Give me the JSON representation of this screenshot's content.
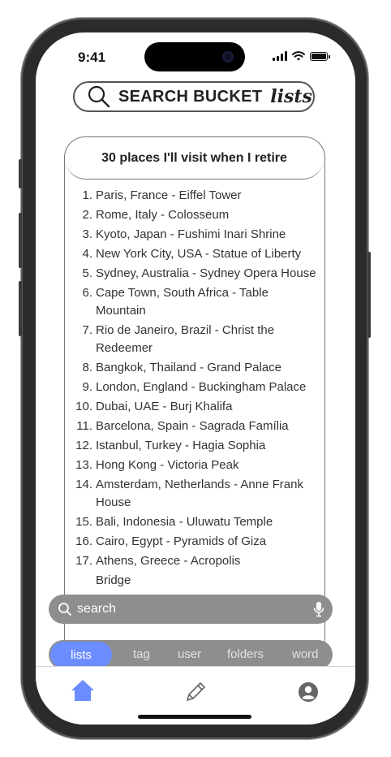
{
  "status": {
    "time": "9:41"
  },
  "header": {
    "search_label": "SEARCH BUCKET",
    "lists_label": "lists"
  },
  "list": {
    "title": "30 places I'll visit when I retire",
    "items": [
      {
        "num": "1.",
        "text": "Paris, France - Eiffel Tower"
      },
      {
        "num": "2.",
        "text": "Rome, Italy - Colosseum"
      },
      {
        "num": "3.",
        "text": "Kyoto, Japan - Fushimi Inari Shrine"
      },
      {
        "num": "4.",
        "text": "New York City, USA - Statue of Liberty"
      },
      {
        "num": "5.",
        "text": "Sydney, Australia - Sydney Opera House"
      },
      {
        "num": "6.",
        "text": "Cape Town, South Africa - Table Mountain"
      },
      {
        "num": "7.",
        "text": "Rio de Janeiro, Brazil - Christ the Redeemer"
      },
      {
        "num": "8.",
        "text": "Bangkok, Thailand - Grand Palace"
      },
      {
        "num": "9.",
        "text": "London, England - Buckingham Palace"
      },
      {
        "num": "10.",
        "text": "Dubai, UAE - Burj Khalifa"
      },
      {
        "num": "11.",
        "text": "Barcelona, Spain - Sagrada Família"
      },
      {
        "num": "12.",
        "text": "Istanbul, Turkey - Hagia Sophia"
      },
      {
        "num": "13.",
        "text": "Hong Kong - Victoria Peak"
      },
      {
        "num": "14.",
        "text": "Amsterdam, Netherlands - Anne Frank House"
      },
      {
        "num": "15.",
        "text": "Bali, Indonesia - Uluwatu Temple"
      },
      {
        "num": "16.",
        "text": "Cairo, Egypt - Pyramids of Giza"
      },
      {
        "num": "17.",
        "text": "Athens, Greece - Acropolis"
      }
    ],
    "partial_text": "Bridge"
  },
  "search": {
    "placeholder": "search"
  },
  "tabs": [
    {
      "label": "lists",
      "active": true
    },
    {
      "label": "tag",
      "active": false
    },
    {
      "label": "user",
      "active": false
    },
    {
      "label": "folders",
      "active": false
    },
    {
      "label": "word",
      "active": false
    }
  ],
  "nav": {
    "home_icon": "home-icon",
    "edit_icon": "pencil-icon",
    "profile_icon": "user-icon"
  },
  "colors": {
    "accent": "#6b8dff",
    "bar_gray": "#8e8e8e"
  }
}
